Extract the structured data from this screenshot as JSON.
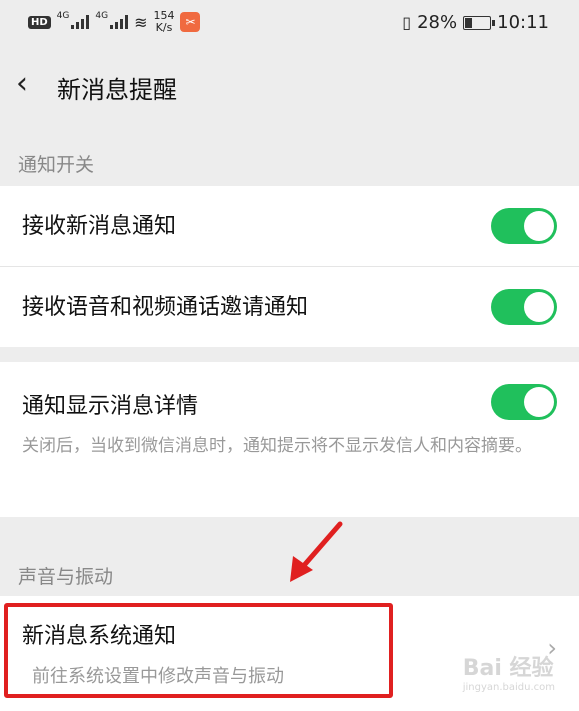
{
  "status_bar": {
    "net1": "4G",
    "net2": "4G",
    "speed_value": "154",
    "speed_unit": "K/s",
    "battery": "28%",
    "time": "10:11"
  },
  "header": {
    "title": "新消息提醒"
  },
  "sections": {
    "notify_switch": "通知开关",
    "sound_vibration": "声音与振动"
  },
  "rows": {
    "receive_new": "接收新消息通知",
    "receive_call": "接收语音和视频通话邀请通知",
    "show_details": "通知显示消息详情",
    "show_details_desc": "关闭后，当收到微信消息时，通知提示将不显示发信人和内容摘要。"
  },
  "toggles": {
    "receive_new": true,
    "receive_call": true,
    "show_details": true
  },
  "system_notify": {
    "title": "新消息系统通知",
    "subtitle": "前往系统设置中修改声音与振动"
  },
  "watermark": {
    "main": "Bai 经验",
    "sub": "jingyan.baidu.com"
  },
  "colors": {
    "toggle_on": "#20c05c",
    "highlight": "#e02020",
    "background": "#ededed"
  }
}
